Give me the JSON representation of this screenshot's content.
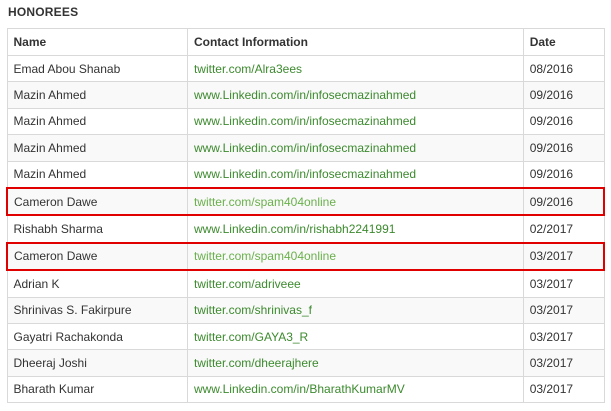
{
  "section": {
    "title": "HONOREES"
  },
  "table": {
    "headers": {
      "name": "Name",
      "contact": "Contact Information",
      "date": "Date"
    },
    "rows": [
      {
        "name": "Emad Abou Shanab",
        "contact": "twitter.com/Alra3ees",
        "date": "08/2016",
        "highlighted": false
      },
      {
        "name": "Mazin Ahmed",
        "contact": "www.Linkedin.com/in/infosecmazinahmed",
        "date": "09/2016",
        "highlighted": false
      },
      {
        "name": "Mazin Ahmed",
        "contact": "www.Linkedin.com/in/infosecmazinahmed",
        "date": "09/2016",
        "highlighted": false
      },
      {
        "name": "Mazin Ahmed",
        "contact": "www.Linkedin.com/in/infosecmazinahmed",
        "date": "09/2016",
        "highlighted": false
      },
      {
        "name": "Mazin Ahmed",
        "contact": "www.Linkedin.com/in/infosecmazinahmed",
        "date": "09/2016",
        "highlighted": false
      },
      {
        "name": "Cameron Dawe",
        "contact": "twitter.com/spam404online",
        "date": "09/2016",
        "highlighted": true
      },
      {
        "name": "Rishabh Sharma",
        "contact": "www.Linkedin.com/in/rishabh2241991",
        "date": "02/2017",
        "highlighted": false
      },
      {
        "name": "Cameron Dawe",
        "contact": "twitter.com/spam404online",
        "date": "03/2017",
        "highlighted": true
      },
      {
        "name": "Adrian K",
        "contact": "twitter.com/adriveee",
        "date": "03/2017",
        "highlighted": false
      },
      {
        "name": "Shrinivas S. Fakirpure",
        "contact": "twitter.com/shrinivas_f",
        "date": "03/2017",
        "highlighted": false
      },
      {
        "name": "Gayatri Rachakonda",
        "contact": "twitter.com/GAYA3_R",
        "date": "03/2017",
        "highlighted": false
      },
      {
        "name": "Dheeraj Joshi",
        "contact": "twitter.com/dheerajhere",
        "date": "03/2017",
        "highlighted": false
      },
      {
        "name": "Bharath Kumar",
        "contact": "www.Linkedin.com/in/BharathKumarMV",
        "date": "03/2017",
        "highlighted": false
      }
    ]
  },
  "colors": {
    "link": "#3c8a2e",
    "link_highlighted": "#6ab04c",
    "highlight_border": "#e00000",
    "grid_border": "#d9d9d9"
  }
}
